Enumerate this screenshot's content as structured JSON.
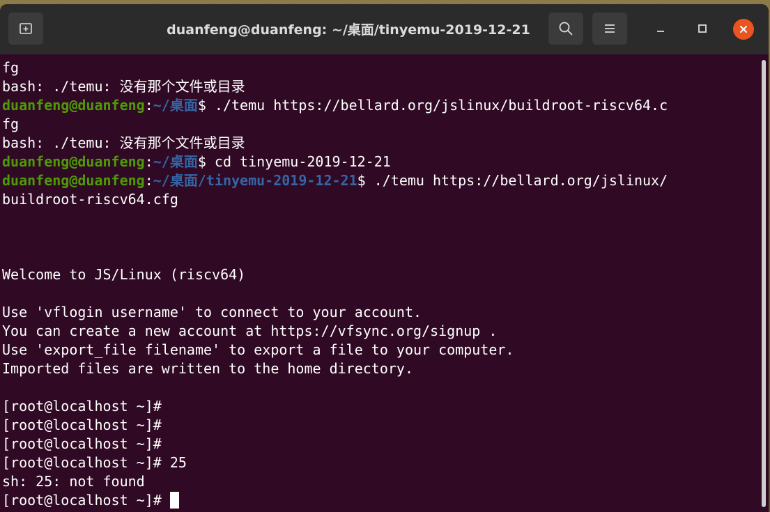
{
  "window": {
    "title": "duanfeng@duanfeng: ~/桌面/tinyemu-2019-12-21"
  },
  "colors": {
    "terminal_bg": "#300a24",
    "prompt_user": "#4e9a06",
    "prompt_path": "#3465a4",
    "close_button": "#e95420"
  },
  "titlebar": {
    "new_tab_icon": "new-tab-icon",
    "search_icon": "search-icon",
    "menu_icon": "hamburger-menu-icon",
    "minimize_icon": "minimize-icon",
    "maximize_icon": "maximize-icon",
    "close_icon": "close-icon"
  },
  "terminal": {
    "l0": "fg",
    "l1": "bash: ./temu: 没有那个文件或目录",
    "l2_user": "duanfeng@duanfeng",
    "l2_colon": ":",
    "l2_path": "~/桌面",
    "l2_cmd": "$ ./temu https://bellard.org/jslinux/buildroot-riscv64.c",
    "l3": "fg",
    "l4": "bash: ./temu: 没有那个文件或目录",
    "l5_user": "duanfeng@duanfeng",
    "l5_colon": ":",
    "l5_path": "~/桌面",
    "l5_cmd": "$ cd tinyemu-2019-12-21",
    "l6_user": "duanfeng@duanfeng",
    "l6_colon": ":",
    "l6_path": "~/桌面/tinyemu-2019-12-21",
    "l6_cmd": "$ ./temu https://bellard.org/jslinux/",
    "l7": "buildroot-riscv64.cfg",
    "l8": "",
    "l9": "",
    "l10": "",
    "l11": "Welcome to JS/Linux (riscv64)",
    "l12": "",
    "l13": "Use 'vflogin username' to connect to your account.",
    "l14": "You can create a new account at https://vfsync.org/signup .",
    "l15": "Use 'export_file filename' to export a file to your computer.",
    "l16": "Imported files are written to the home directory.",
    "l17": "",
    "l18": "[root@localhost ~]#",
    "l19": "[root@localhost ~]#",
    "l20": "[root@localhost ~]#",
    "l21": "[root@localhost ~]# 25",
    "l22": "sh: 25: not found",
    "l23": "[root@localhost ~]# "
  }
}
